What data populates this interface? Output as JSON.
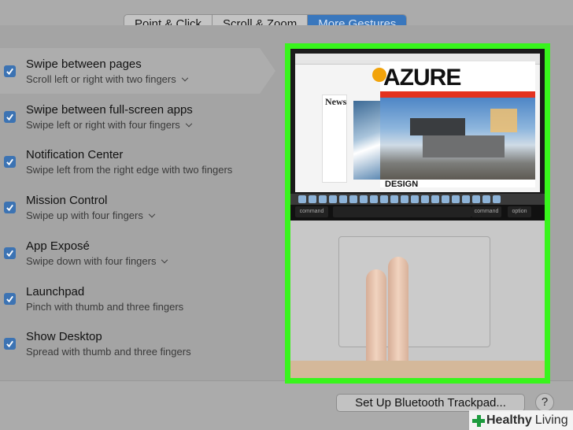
{
  "tabs": [
    {
      "label": "Point & Click"
    },
    {
      "label": "Scroll & Zoom"
    },
    {
      "label": "More Gestures"
    }
  ],
  "gestures": [
    {
      "title": "Swipe between pages",
      "subtitle": "Scroll left or right with two fingers",
      "has_dropdown": true,
      "checked": true
    },
    {
      "title": "Swipe between full-screen apps",
      "subtitle": "Swipe left or right with four fingers",
      "has_dropdown": true,
      "checked": true
    },
    {
      "title": "Notification Center",
      "subtitle": "Swipe left from the right edge with two fingers",
      "has_dropdown": false,
      "checked": true
    },
    {
      "title": "Mission Control",
      "subtitle": "Swipe up with four fingers",
      "has_dropdown": true,
      "checked": true
    },
    {
      "title": "App Exposé",
      "subtitle": "Swipe down with four fingers",
      "has_dropdown": true,
      "checked": true
    },
    {
      "title": "Launchpad",
      "subtitle": "Pinch with thumb and three fingers",
      "has_dropdown": false,
      "checked": true
    },
    {
      "title": "Show Desktop",
      "subtitle": "Spread with thumb and three fingers",
      "has_dropdown": false,
      "checked": true
    }
  ],
  "preview": {
    "magazine_title": "AZURE",
    "news_label": "News",
    "design_label": "DESIGN",
    "keys": [
      "command",
      "command",
      "option"
    ]
  },
  "footer": {
    "bluetooth_button": "Set Up Bluetooth Trackpad...",
    "help_button": "?"
  },
  "watermark": {
    "brand1": "Healthy",
    "brand2": "Living"
  },
  "colors": {
    "accent": "#3977bd",
    "checkbox": "#3c73b3",
    "highlight_border": "#38f51c"
  }
}
